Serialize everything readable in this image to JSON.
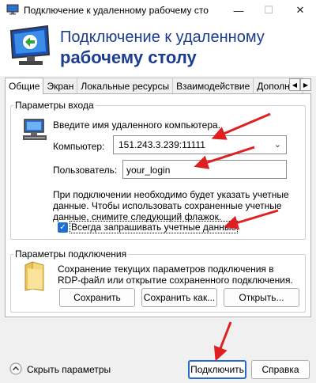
{
  "window": {
    "title": "Подключение к удаленному рабочему сто",
    "minimize_glyph": "—",
    "maximize_glyph": "☐",
    "close_glyph": "✕"
  },
  "banner": {
    "line1": "Подключение к удаленному",
    "line2": "рабочему столу"
  },
  "tabs": [
    {
      "label": "Общие",
      "active": true
    },
    {
      "label": "Экран",
      "active": false
    },
    {
      "label": "Локальные ресурсы",
      "active": false
    },
    {
      "label": "Взаимодействие",
      "active": false
    },
    {
      "label": "Дополнит",
      "active": false
    }
  ],
  "tab_scroll": {
    "left": "◀",
    "right": "▶"
  },
  "login_group": {
    "title": "Параметры входа",
    "prompt": "Введите имя удаленного компьютера.",
    "computer_label": "Компьютер:",
    "computer_value": "151.243.3.239:11111",
    "user_label": "Пользователь:",
    "user_value": "your_login",
    "info_line1": "При подключении необходимо будет указать учетные",
    "info_line2": "данные. Чтобы использовать сохраненные учетные",
    "info_line3": "данные, снимите следующий флажок.",
    "always_ask_label": "Всегда запрашивать учетные данные",
    "always_ask_checked": true
  },
  "connection_group": {
    "title": "Параметры подключения",
    "desc_line1": "Сохранение текущих параметров подключения в",
    "desc_line2": "RDP-файл или открытие сохраненного подключения.",
    "save_button": "Сохранить",
    "save_as_button": "Сохранить как...",
    "open_button": "Открыть..."
  },
  "footer": {
    "hide_options": "Скрыть параметры",
    "connect_button": "Подключить",
    "help_button": "Справка"
  },
  "colors": {
    "banner_text": "#1c3d8e",
    "annotation_arrow": "#e02020",
    "checkbox": "#1e6fd0"
  }
}
